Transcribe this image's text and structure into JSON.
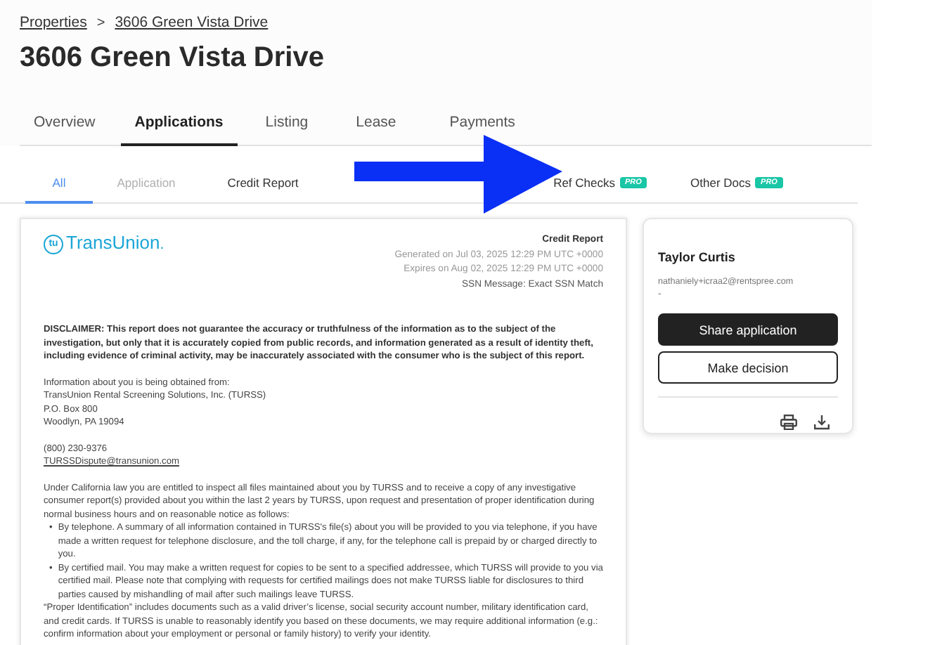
{
  "breadcrumb": [
    {
      "label": "Properties"
    },
    {
      "label": "3606 Green Vista Drive"
    }
  ],
  "breadcrumb_separator": ">",
  "title": "3606 Green Vista Drive",
  "tabs": [
    {
      "label": "Overview",
      "selected": false
    },
    {
      "label": "Applications",
      "selected": true
    },
    {
      "label": "Listing",
      "selected": false
    },
    {
      "label": "Lease",
      "selected": false
    },
    {
      "label": "Payments",
      "selected": false
    }
  ],
  "subtabs": [
    {
      "label": "All",
      "selected": true,
      "disabled": false
    },
    {
      "label": "Application",
      "selected": false,
      "disabled": true
    },
    {
      "label": "Credit Report",
      "selected": false,
      "disabled": false
    },
    {
      "label": "Ref Checks",
      "selected": false,
      "disabled": false,
      "badge": "PRO"
    },
    {
      "label": "Other Docs",
      "selected": false,
      "disabled": false,
      "badge": "PRO"
    }
  ],
  "report": {
    "logo_mark": "tu",
    "logo_text": "TransUnion",
    "logo_suffix": ".",
    "heading": "Credit Report",
    "meta": [
      "Generated on Jul 03, 2025 12:29 PM UTC +0000",
      "Expires on Aug 02, 2025 12:29 PM UTC +0000"
    ],
    "ssn": "SSN Message: Exact SSN Match",
    "disclaimer": "DISCLAIMER: This report does not guarantee the accuracy or truthfulness of the information as to the subject of the investigation, but only that it is accurately copied from public records, and information generated as a result of identity theft, including evidence of criminal activity, may be inaccurately associated with the consumer who is the subject of this report.",
    "source": [
      "Information about you is being obtained from:",
      "TransUnion Rental Screening Solutions, Inc. (TURSS)",
      "P.O. Box 800",
      "Woodlyn, PA 19094"
    ],
    "phone": "(800) 230-9376",
    "email": "TURSSDispute@transunion.com",
    "notice": "Under California law you are entitled to inspect all files maintained about you by TURSS and to receive a copy of any investigative consumer report(s) provided about you within the last 2 years by TURSS, upon request and presentation of proper identification during normal business hours and on reasonable notice as follows:",
    "bullets": [
      "By telephone. A summary of all information contained in TURSS's file(s) about you will be provided to you via telephone, if you have made a written request for telephone disclosure, and the toll charge, if any, for the telephone call is prepaid by or charged directly to you.",
      "By certified mail. You may make a written request for copies to be sent to a specified addressee, which TURSS will provide to you via certified mail. Please note that complying with requests for certified mailings does not make TURSS liable for disclosures to third parties caused by mishandling of mail after such mailings leave TURSS."
    ],
    "bullet_mark": "•",
    "proper_id": "“Proper Identification” includes documents such as a valid driver’s license, social security account number, military identification card, and credit cards. If TURSS is unable to reasonably identify you based on these documents, we may require additional information (e.g.: confirm information about your employment or personal or family history) to verify your identity."
  },
  "applicant": {
    "name": "Taylor Curtis",
    "email": "nathaniely+icraa2@rentspree.com",
    "phone": "-",
    "buttons": [
      {
        "label": "Share application",
        "kind": "primary"
      },
      {
        "label": "Make decision",
        "kind": "secondary"
      }
    ]
  }
}
